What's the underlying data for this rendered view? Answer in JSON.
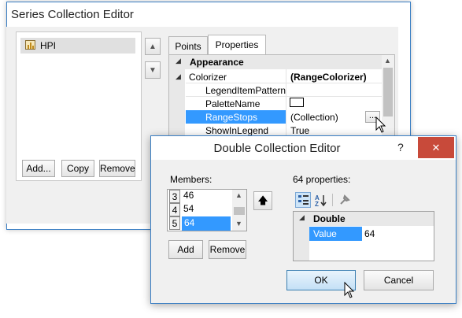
{
  "series_editor": {
    "title": "Series Collection Editor",
    "series_items": [
      "HPI"
    ],
    "buttons": {
      "add": "Add...",
      "copy": "Copy",
      "remove": "Remove"
    },
    "tabs": [
      "Points",
      "Properties"
    ],
    "property_grid": {
      "category": "Appearance",
      "rows": [
        {
          "name": "Colorizer",
          "value": "(RangeColorizer)"
        },
        {
          "name": "LegendItemPattern",
          "value": ""
        },
        {
          "name": "PaletteName",
          "value": ""
        },
        {
          "name": "RangeStops",
          "value": "(Collection)",
          "ellipsis": "..."
        },
        {
          "name": "ShowInLegend",
          "value": "True"
        }
      ]
    }
  },
  "double_editor": {
    "title": "Double Collection Editor",
    "help_label": "?",
    "close_label": "✕",
    "members_label": "Members:",
    "members": [
      {
        "index": "3",
        "value": "46"
      },
      {
        "index": "4",
        "value": "54"
      },
      {
        "index": "5",
        "value": "64"
      }
    ],
    "properties_label": "64 properties:",
    "property_category": "Double",
    "property_row": {
      "name": "Value",
      "value": "64"
    },
    "buttons": {
      "add": "Add",
      "remove": "Remove",
      "ok": "OK",
      "cancel": "Cancel"
    }
  },
  "colors": {
    "selection": "#3399ff",
    "window_border": "#3b7fc4",
    "close_button": "#c84a3a"
  }
}
